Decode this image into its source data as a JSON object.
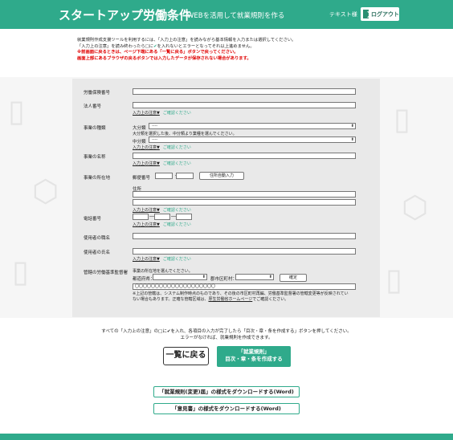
{
  "header": {
    "brand": "スタートアップ労働条件",
    "tagline": "WEBを活用して就業規則を作る",
    "user_label": "テキスト様",
    "logout_label": "ログアウト"
  },
  "intro": {
    "line1": "就業規則作成支援ツールを利用するには、「入力上の注意」を読みながら基本情報を入力または選択してください。",
    "line2a": "「入力上の注意」を読み終わったら",
    "line2b": "□に",
    "line2c": "を入れないとエラーとなってそれ以上進めません。",
    "check_glyph": "✔",
    "warn1": "※前画面に戻るときは、ページ下端にある「一覧に戻る」ボタンで戻ってください。",
    "warn2": "画面上部にあるブラウザの戻るボタンでは入力したデータが保存されない場合があります。"
  },
  "form": {
    "labor_insurance_label": "労働保険番号",
    "corp_number_label": "法人番号",
    "business_type_label": "事業の種類",
    "major_label": "大分類",
    "major_value": "----",
    "major_hint": "大分類を選択した後、中分類より業種を選んでください。",
    "middle_label": "中分類",
    "middle_value": "----",
    "biz_name_label": "事業の名称",
    "location_label": "事業の所在地",
    "postal_label": "郵便番号",
    "postal_dash": "―",
    "auto_address_btn": "住所自動入力",
    "address_label": "住所",
    "phone_label": "電話番号",
    "phone_dash": "―",
    "employer_title_label": "使用者の職名",
    "employer_name_label": "使用者の氏名",
    "bureau_label": "管轄の労働基準監督署",
    "bureau_select_hint": "事業の所在地を選んでください。",
    "prefecture_label": "都道府県：",
    "city_label": "郡市区町村：",
    "confirm_btn": "確定",
    "bureau_value": "〇〇〇〇〇〇〇〇〇〇〇〇〇〇〇〇〇〇〇〇",
    "note_line1": "※上記の管轄は、システム制作時点のものであり、その後の市区町村再編、労働基準監督署の管轄変更等が反映されてい",
    "note_line2a": "ない場合もあります。正確な管轄区域は、",
    "note_line2b": "厚生労働省ホームページ",
    "note_line2c": "でご確認ください。",
    "input_notice": "入力上の注意▼",
    "confirm_please": "ご確認ください"
  },
  "bottom": {
    "note1": "すべての「入力上の注意」の□に✔を入れ、各項目の入力が完了したら「目次・章・条を作成する」ボタンを押してください。",
    "note2": "エラーがなければ、就業規則を作成できます。",
    "back_btn": "一覧に戻る",
    "create_btn_line1": "「就業規則」",
    "create_btn_line2": "目次・章・条を作成する",
    "dl1": "「就業規則(変更)届」の様式をダウンロードする(Word)",
    "dl2": "「意見書」の様式をダウンロードする(Word)"
  },
  "colors": {
    "accent": "#2faa8b",
    "warning": "#e00000"
  }
}
